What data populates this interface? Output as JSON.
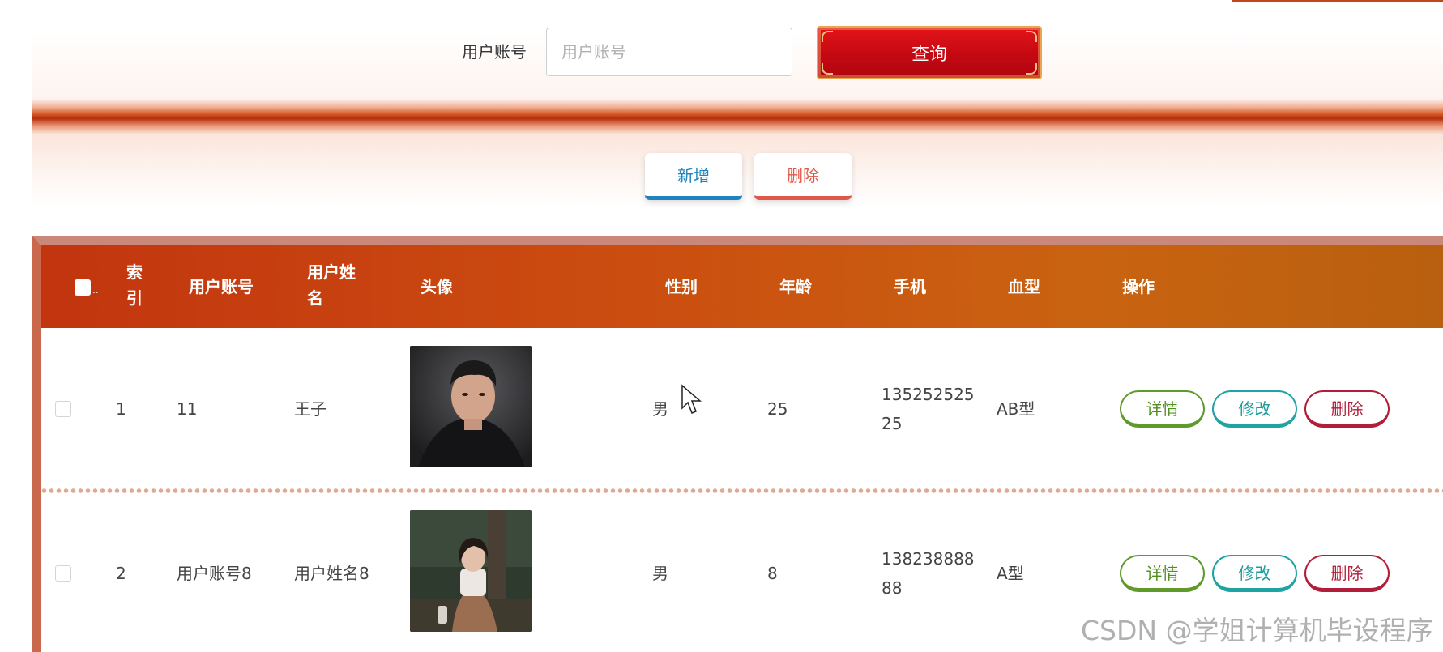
{
  "search": {
    "label": "用户账号",
    "placeholder": "用户账号",
    "value": "",
    "query_label": "查询"
  },
  "actions": {
    "add_label": "新增",
    "delete_label": "删除"
  },
  "table": {
    "headers": {
      "index": "索引",
      "account": "用户账号",
      "name": "用户姓名",
      "avatar": "头像",
      "gender": "性别",
      "age": "年龄",
      "phone": "手机",
      "blood": "血型",
      "ops": "操作"
    },
    "rows": [
      {
        "index": "1",
        "account": "11",
        "name": "王子",
        "avatar_icon": "male-portrait",
        "gender": "男",
        "age": "25",
        "phone_line1": "135252525",
        "phone_line2": "25",
        "blood": "AB型",
        "op_detail": "详情",
        "op_edit": "修改",
        "op_delete": "删除"
      },
      {
        "index": "2",
        "account": "用户账号8",
        "name": "用户姓名8",
        "avatar_icon": "female-portrait",
        "gender": "男",
        "age": "8",
        "phone_line1": "138238888",
        "phone_line2": "88",
        "blood": "A型",
        "op_detail": "详情",
        "op_edit": "修改",
        "op_delete": "删除"
      }
    ]
  },
  "watermark": "CSDN @学姐计算机毕设程序",
  "colors": {
    "query_red": "#c40812",
    "header_orange": "#c2350f",
    "add_blue": "#1f84be",
    "delete_red": "#e0584a",
    "detail_green": "#5f9a2a",
    "edit_teal": "#1fa3a3",
    "op_delete_crimson": "#b21d3a"
  }
}
